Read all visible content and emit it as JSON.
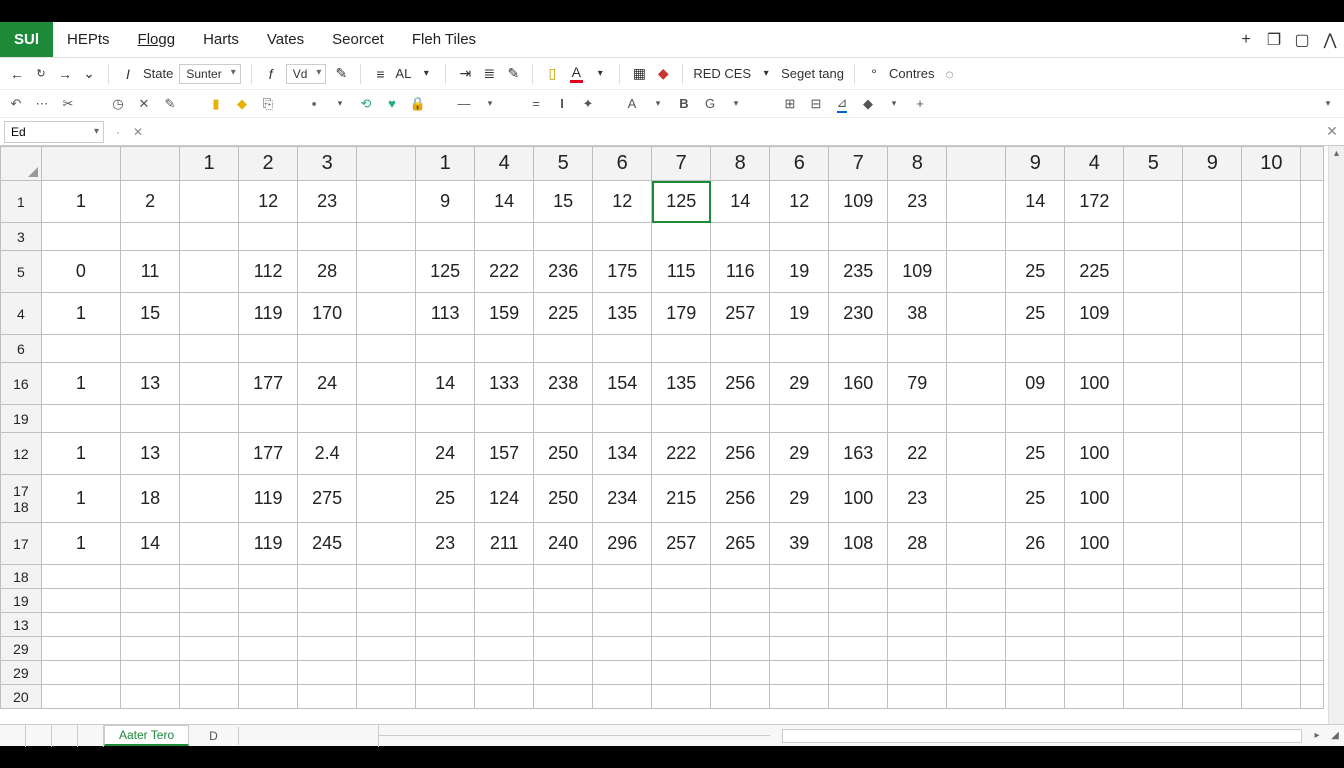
{
  "menu": {
    "logo": "SUl",
    "items": [
      "HEPts",
      "Flogg",
      "Harts",
      "Vates",
      "Seorcet",
      "Fleh Tiles"
    ]
  },
  "ribbon1": {
    "state_label": "State",
    "font_combo": "Sunter",
    "size_combo": "Vd",
    "align_label": "AL",
    "redces": "RED CES",
    "seget": "Seget  tang",
    "contres": "Contres"
  },
  "namebox": "Ed",
  "col_headers": [
    "",
    "",
    "1",
    "2",
    "3",
    "",
    "1",
    "4",
    "5",
    "6",
    "7",
    "8",
    "6",
    "7",
    "8",
    "",
    "9",
    "4",
    "5",
    "9",
    "10",
    ""
  ],
  "rows": [
    {
      "hdr": "1",
      "cls": "data",
      "cells": [
        "1",
        "2",
        "",
        "12",
        "23",
        "",
        "9",
        "14",
        "15",
        "12",
        "125",
        "14",
        "12",
        "109",
        "23",
        "",
        "14",
        "172",
        "",
        "",
        "",
        ""
      ],
      "sel": 10
    },
    {
      "hdr": "3",
      "cls": "thin",
      "cells": [
        "",
        "",
        "",
        "",
        "",
        "",
        "",
        "",
        "",
        "",
        "",
        "",
        "",
        "",
        "",
        "",
        "",
        "",
        "",
        "",
        "",
        ""
      ]
    },
    {
      "hdr": "5",
      "cls": "data",
      "cells": [
        "0",
        "11",
        "",
        "112",
        "28",
        "",
        "125",
        "222",
        "236",
        "175",
        "115",
        "116",
        "19",
        "235",
        "109",
        "",
        "25",
        "225",
        "",
        "",
        "",
        ""
      ]
    },
    {
      "hdr": "4",
      "cls": "data",
      "cells": [
        "1",
        "15",
        "",
        "119",
        "170",
        "",
        "113",
        "159",
        "225",
        "135",
        "179",
        "257",
        "19",
        "230",
        "38",
        "",
        "25",
        "109",
        "",
        "",
        "",
        ""
      ]
    },
    {
      "hdr": "6",
      "cls": "thin",
      "cells": [
        "",
        "",
        "",
        "",
        "",
        "",
        "",
        "",
        "",
        "",
        "",
        "",
        "",
        "",
        "",
        "",
        "",
        "",
        "",
        "",
        "",
        ""
      ]
    },
    {
      "hdr": "16",
      "cls": "data",
      "cells": [
        "1",
        "13",
        "",
        "177",
        "24",
        "",
        "14",
        "133",
        "238",
        "154",
        "135",
        "256",
        "29",
        "160",
        "79",
        "",
        "09",
        "100",
        "",
        "",
        "",
        ""
      ]
    },
    {
      "hdr": "19",
      "cls": "thin",
      "cells": [
        "",
        "",
        "",
        "",
        "",
        "",
        "",
        "",
        "",
        "",
        "",
        "",
        "",
        "",
        "",
        "",
        "",
        "",
        "",
        "",
        "",
        ""
      ]
    },
    {
      "hdr": "12",
      "cls": "data",
      "cells": [
        "1",
        "13",
        "",
        "177",
        "2.4",
        "",
        "24",
        "157",
        "250",
        "134",
        "222",
        "256",
        "29",
        "163",
        "22",
        "",
        "25",
        "100",
        "",
        "",
        "",
        ""
      ]
    },
    {
      "hdr": "17\n18",
      "cls": "dbl",
      "cells": [
        "1",
        "18",
        "",
        "119",
        "275",
        "",
        "25",
        "124",
        "250",
        "234",
        "215",
        "256",
        "29",
        "100",
        "23",
        "",
        "25",
        "100",
        "",
        "",
        "",
        ""
      ]
    },
    {
      "hdr": "17",
      "cls": "data",
      "cells": [
        "1",
        "14",
        "",
        "119",
        "245",
        "",
        "23",
        "211",
        "240",
        "296",
        "257",
        "265",
        "39",
        "108",
        "28",
        "",
        "26",
        "100",
        "",
        "",
        "",
        ""
      ]
    },
    {
      "hdr": "18",
      "cls": "short",
      "cells": [
        "",
        "",
        "",
        "",
        "",
        "",
        "",
        "",
        "",
        "",
        "",
        "",
        "",
        "",
        "",
        "",
        "",
        "",
        "",
        "",
        "",
        ""
      ]
    },
    {
      "hdr": "19",
      "cls": "short",
      "cells": [
        "",
        "",
        "",
        "",
        "",
        "",
        "",
        "",
        "",
        "",
        "",
        "",
        "",
        "",
        "",
        "",
        "",
        "",
        "",
        "",
        "",
        ""
      ]
    },
    {
      "hdr": "13",
      "cls": "short",
      "cells": [
        "",
        "",
        "",
        "",
        "",
        "",
        "",
        "",
        "",
        "",
        "",
        "",
        "",
        "",
        "",
        "",
        "",
        "",
        "",
        "",
        "",
        ""
      ]
    },
    {
      "hdr": "29",
      "cls": "short",
      "cells": [
        "",
        "",
        "",
        "",
        "",
        "",
        "",
        "",
        "",
        "",
        "",
        "",
        "",
        "",
        "",
        "",
        "",
        "",
        "",
        "",
        "",
        ""
      ]
    },
    {
      "hdr": "29",
      "cls": "short",
      "cells": [
        "",
        "",
        "",
        "",
        "",
        "",
        "",
        "",
        "",
        "",
        "",
        "",
        "",
        "",
        "",
        "",
        "",
        "",
        "",
        "",
        "",
        ""
      ]
    },
    {
      "hdr": "20",
      "cls": "short",
      "cells": [
        "",
        "",
        "",
        "",
        "",
        "",
        "",
        "",
        "",
        "",
        "",
        "",
        "",
        "",
        "",
        "",
        "",
        "",
        "",
        "",
        "",
        ""
      ]
    }
  ],
  "sheet": {
    "tab1": "Aater Tero",
    "tab2": "D"
  }
}
